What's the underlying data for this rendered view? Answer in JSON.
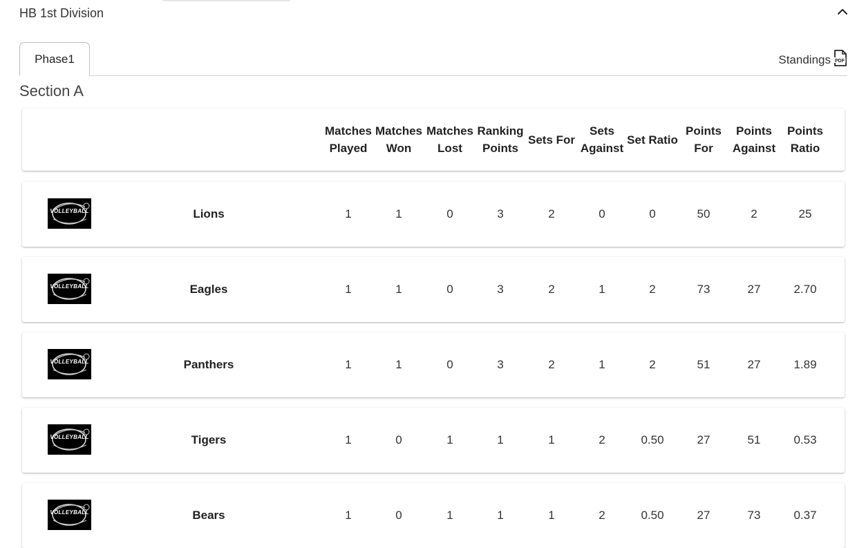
{
  "division": {
    "title": "HB 1st Division",
    "collapse_icon": "chevron-up-icon"
  },
  "tabs": [
    {
      "label": "Phase1",
      "active": true
    }
  ],
  "standings_link": {
    "label": "Standings",
    "icon": "pdf-icon",
    "icon_text": "PDF"
  },
  "section": {
    "title": "Section A"
  },
  "table": {
    "columns": [
      "Matches Played",
      "Matches Won",
      "Matches Lost",
      "Ranking Points",
      "Sets For",
      "Sets Against",
      "Set Ratio",
      "Points For",
      "Points Against",
      "Points Ratio"
    ],
    "rows": [
      {
        "team": "Lions",
        "logo": "VOLLEYBALL",
        "values": [
          "1",
          "1",
          "0",
          "3",
          "2",
          "0",
          "0",
          "50",
          "2",
          "25"
        ]
      },
      {
        "team": "Eagles",
        "logo": "VOLLEYBALL",
        "values": [
          "1",
          "1",
          "0",
          "3",
          "2",
          "1",
          "2",
          "73",
          "27",
          "2.70"
        ]
      },
      {
        "team": "Panthers",
        "logo": "VOLLEYBALL",
        "values": [
          "1",
          "1",
          "0",
          "3",
          "2",
          "1",
          "2",
          "51",
          "27",
          "1.89"
        ]
      },
      {
        "team": "Tigers",
        "logo": "VOLLEYBALL",
        "values": [
          "1",
          "0",
          "1",
          "1",
          "1",
          "2",
          "0.50",
          "27",
          "51",
          "0.53"
        ]
      },
      {
        "team": "Bears",
        "logo": "VOLLEYBALL",
        "values": [
          "1",
          "0",
          "1",
          "1",
          "1",
          "2",
          "0.50",
          "27",
          "73",
          "0.37"
        ]
      }
    ]
  },
  "colors": {
    "text": "#212121",
    "border": "#d0d0d0",
    "logo_bg": "#000000"
  }
}
